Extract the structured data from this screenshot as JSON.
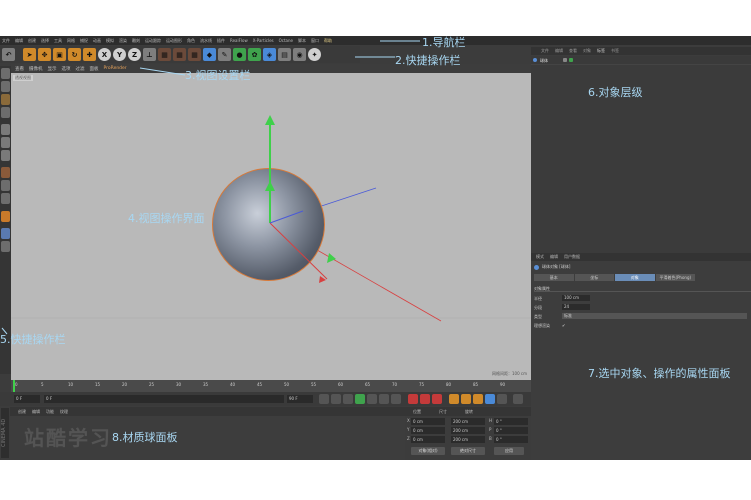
{
  "menu": {
    "items": [
      "文件",
      "编辑",
      "创建",
      "选择",
      "工具",
      "网格",
      "捕捉",
      "动画",
      "模拟",
      "渲染",
      "雕刻",
      "运动跟踪",
      "运动图形",
      "角色",
      "流水线",
      "插件",
      "RealFlow",
      "X-Particles",
      "Octane",
      "脚本",
      "窗口",
      "帮助"
    ]
  },
  "viewport_menu": {
    "items": [
      "查看",
      "摄像机",
      "显示",
      "选项",
      "过滤",
      "面板",
      "ProRender"
    ],
    "camera_label": "透视视图",
    "status_text": "网格间距：100 cm"
  },
  "timeline": {
    "ticks": [
      "0",
      "5",
      "10",
      "15",
      "20",
      "25",
      "30",
      "35",
      "40",
      "45",
      "50",
      "55",
      "60",
      "65",
      "70",
      "75",
      "80",
      "85",
      "90"
    ],
    "start_field": "0 F",
    "current_field": "0 F",
    "end_field": "90 F",
    "end_field2": "90 F",
    "frame_readout": "0 F"
  },
  "material_manager": {
    "tabs": [
      "创建",
      "编辑",
      "功能",
      "纹理"
    ],
    "watermark": "站酷学习",
    "logo_text": "CINEMA 4D"
  },
  "coordinates": {
    "tabs": [
      "位置",
      "尺寸",
      "旋转"
    ],
    "rows": [
      {
        "axis": "X",
        "pos": "0 cm",
        "size": "200 cm",
        "rot_label": "H",
        "rot": "0 °"
      },
      {
        "axis": "Y",
        "pos": "0 cm",
        "size": "200 cm",
        "rot_label": "P",
        "rot": "0 °"
      },
      {
        "axis": "Z",
        "pos": "0 cm",
        "size": "200 cm",
        "rot_label": "B",
        "rot": "0 °"
      }
    ],
    "mode_button": "对象(相对)",
    "size_button": "绝对尺寸",
    "apply_button": "应用"
  },
  "object_manager": {
    "tabs": [
      "文件",
      "编辑",
      "查看",
      "对象",
      "标签",
      "书签"
    ],
    "active_tab": "对象",
    "object_name": "球体"
  },
  "attribute_manager": {
    "tabs": [
      "模式",
      "编辑",
      "用户数据"
    ],
    "object_label": "球体对象 [球体]",
    "subtabs": [
      "基本",
      "坐标",
      "对象",
      "平滑着色(Phong)"
    ],
    "active_subtab": "对象",
    "section_title": "对象属性",
    "props": [
      {
        "label": "半径",
        "value": "100 cm"
      },
      {
        "label": "分段",
        "value": "24"
      },
      {
        "label": "类型",
        "value": "标准"
      },
      {
        "label": "理想渲染",
        "value": "✔"
      }
    ]
  },
  "annotations": {
    "a1": "1.导航栏",
    "a2": "2.快捷操作栏",
    "a3": "3.视图设置栏",
    "a4": "4.视图操作界面",
    "a5": "5.快捷操作栏",
    "a6": "6.对象层级",
    "a7": "7.选中对象、操作的属性面板",
    "a8": "8.材质球面板"
  },
  "colors": {
    "annotation": "#a8d7f2",
    "selection_outline": "#d77a3a",
    "y_axis": "#3fd04a",
    "x_axis": "#d84040",
    "z_axis": "#4a5ad8"
  },
  "icons": [
    "undo-icon",
    "select-icon",
    "move-icon",
    "scale-icon",
    "rotate-icon",
    "axis-x-icon",
    "axis-y-icon",
    "axis-z-icon",
    "coord-system-icon",
    "render-region-icon",
    "render-view-icon",
    "render-settings-icon",
    "cube-icon",
    "pen-icon",
    "subdivision-icon",
    "array-icon",
    "deformer-icon",
    "environment-icon",
    "camera-icon",
    "light-icon"
  ]
}
